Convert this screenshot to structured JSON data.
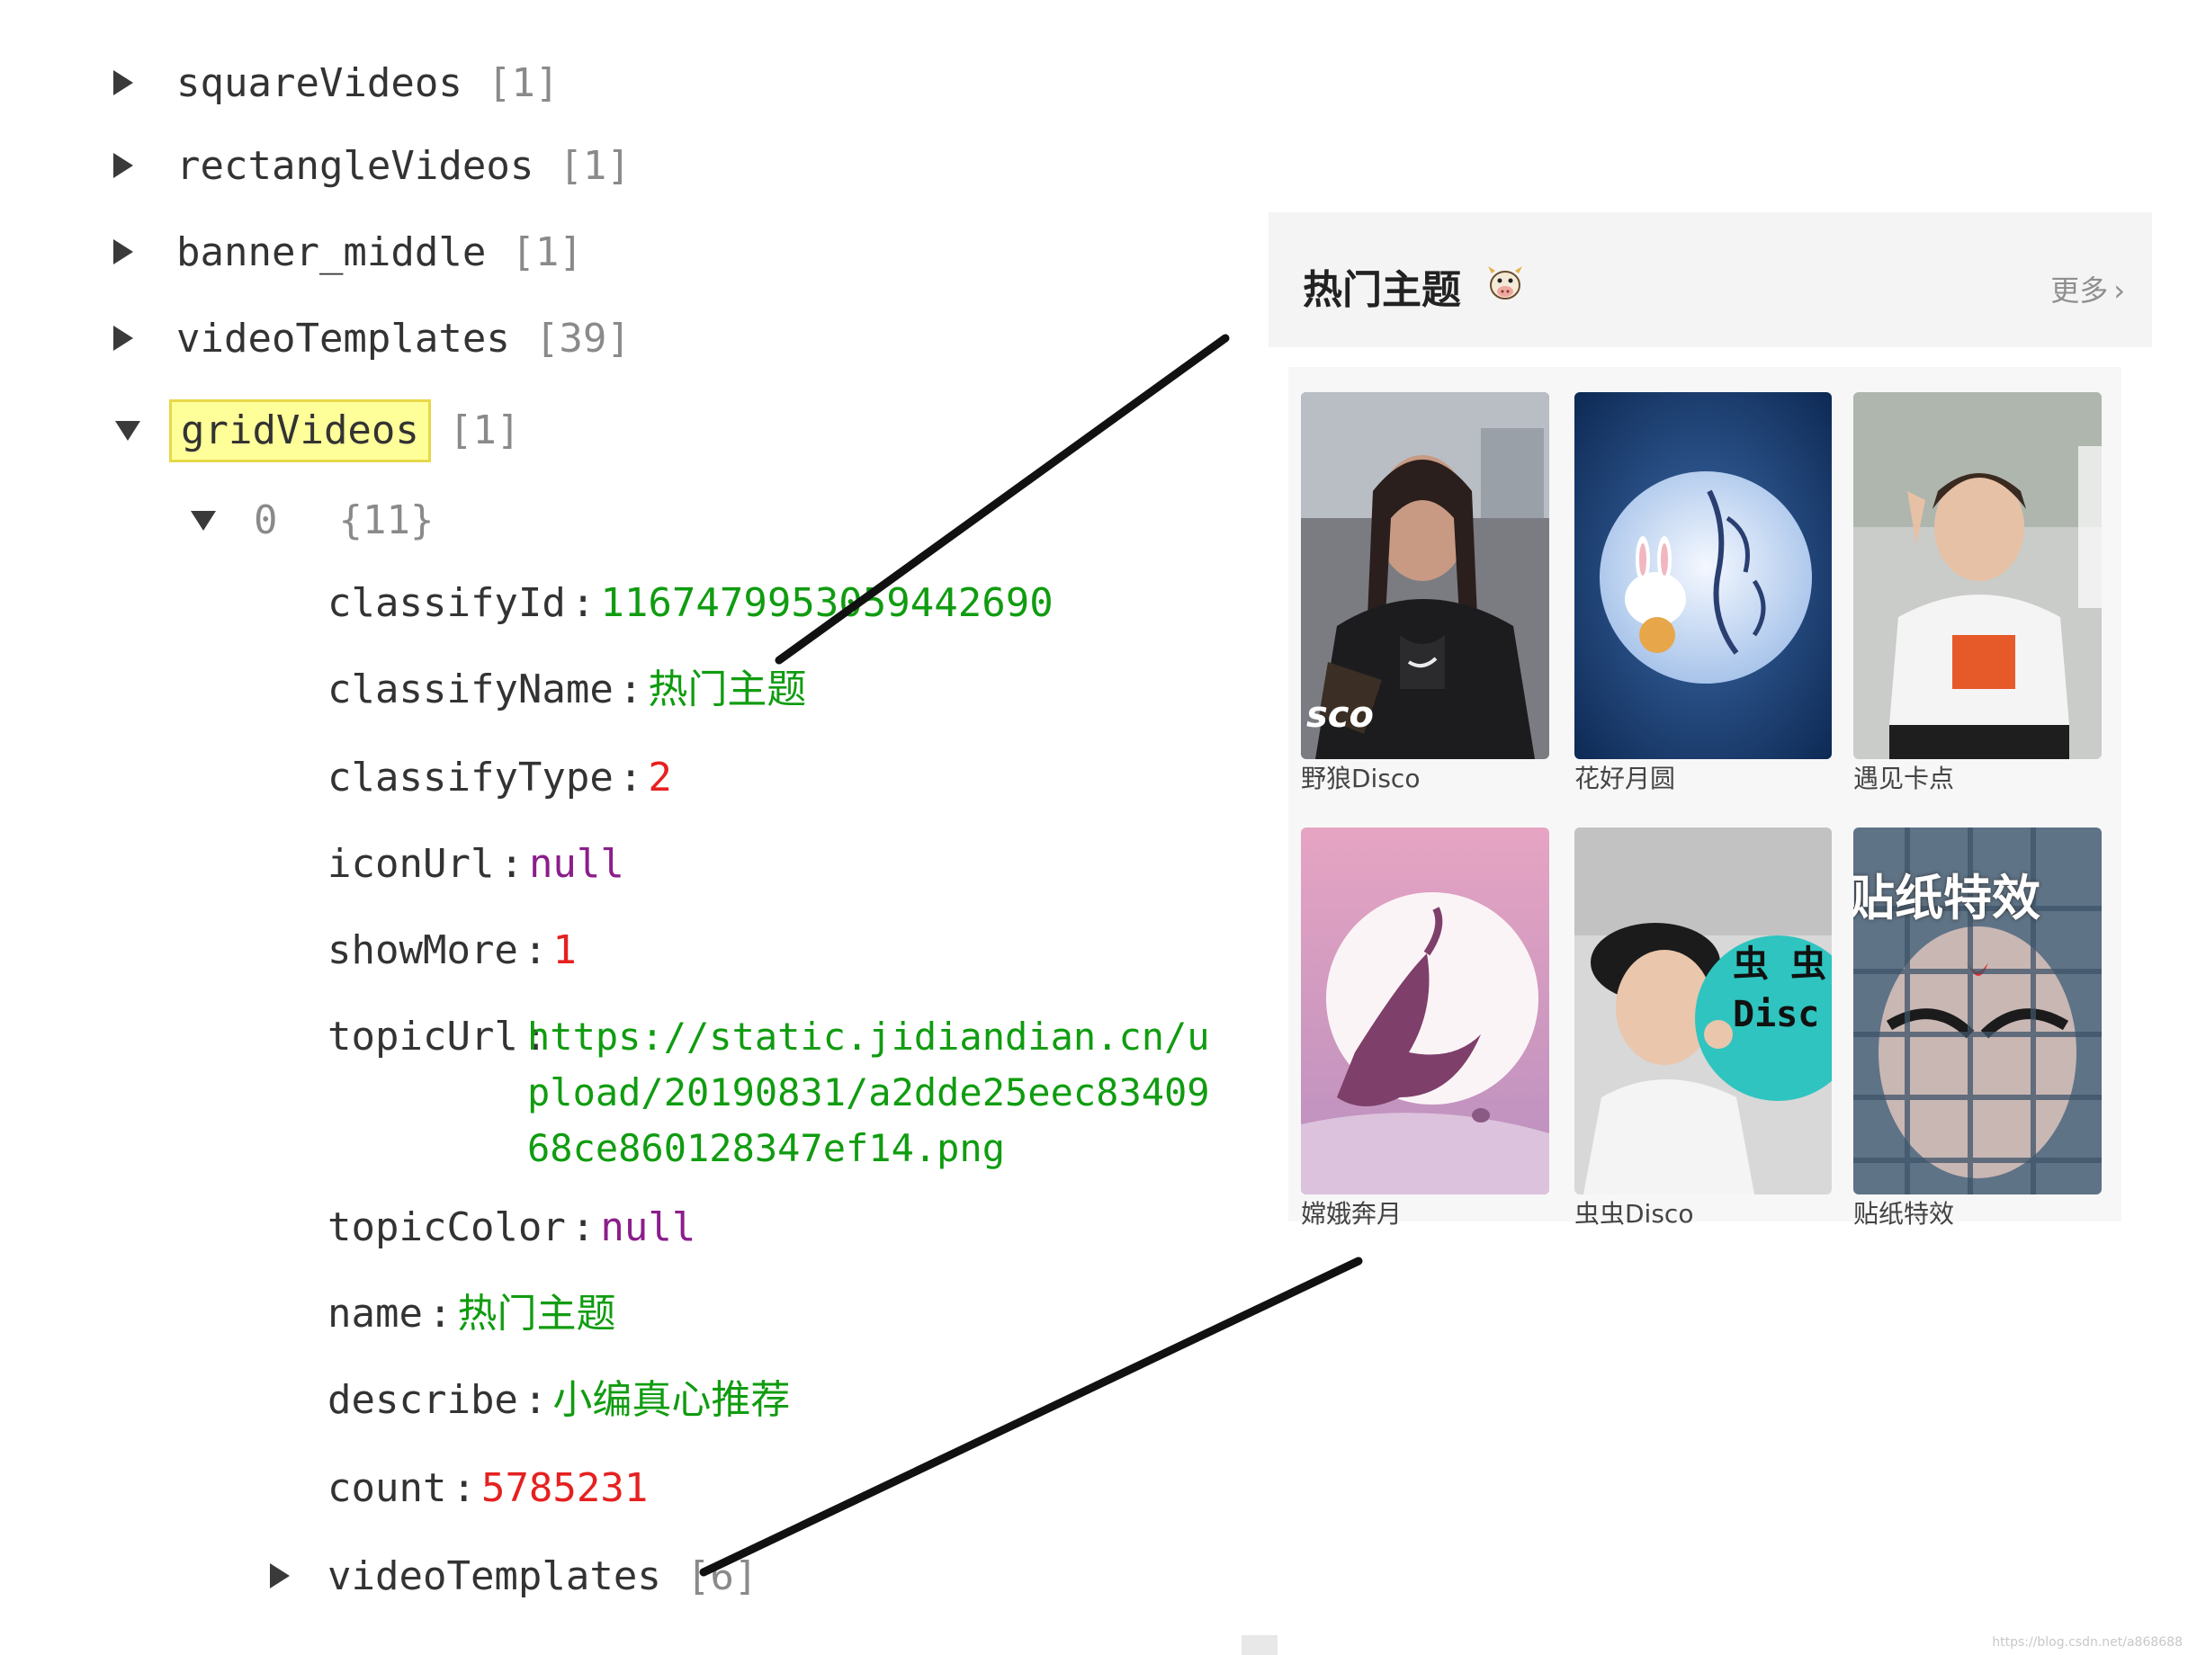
{
  "tree": {
    "top_nodes": [
      {
        "key": "squareVideos",
        "count": "[1]"
      },
      {
        "key": "rectangleVideos",
        "count": "[1]"
      },
      {
        "key": "banner_middle",
        "count": "[1]"
      },
      {
        "key": "videoTemplates",
        "count": "[39]"
      }
    ],
    "grid_node": {
      "key": "gridVideos",
      "count": "[1]"
    },
    "item_node": {
      "key": "0",
      "count": "{11}"
    },
    "fields": [
      {
        "key": "classifyId",
        "value": "1167479953059442690",
        "kind": "str"
      },
      {
        "key": "classifyName",
        "value": "热门主题",
        "kind": "str"
      },
      {
        "key": "classifyType",
        "value": "2",
        "kind": "num"
      },
      {
        "key": "iconUrl",
        "value": "null",
        "kind": "null"
      },
      {
        "key": "showMore",
        "value": "1",
        "kind": "num"
      }
    ],
    "topic_url": {
      "key": "topicUrl",
      "lines": [
        "https://static.jidiandian.cn/u",
        "pload/20190831/a2dde25eec83409",
        "68ce860128347ef14.png"
      ]
    },
    "fields_after": [
      {
        "key": "topicColor",
        "value": "null",
        "kind": "null"
      },
      {
        "key": "name",
        "value": "热门主题",
        "kind": "str"
      },
      {
        "key": "describe",
        "value": "小编真心推荐",
        "kind": "str"
      },
      {
        "key": "count",
        "value": "5785231",
        "kind": "num"
      }
    ],
    "child_node": {
      "key": "videoTemplates",
      "count": "[6]"
    }
  },
  "panel": {
    "title": "热门主题",
    "title_icon": "cow-emoji-icon",
    "more_label": "更多",
    "more_icon": "chevron-right-icon"
  },
  "grid": {
    "items": [
      {
        "label": "野狼Disco",
        "overlay": "sco"
      },
      {
        "label": "花好月圆",
        "overlay": ""
      },
      {
        "label": "遇见卡点",
        "overlay": ""
      },
      {
        "label": "嫦娥奔月",
        "overlay": ""
      },
      {
        "label": "虫虫Disco",
        "overlay": "虫 虫 Disc"
      },
      {
        "label": "贴纸特效",
        "overlay": "贴纸特效"
      }
    ]
  },
  "watermark": "https://blog.csdn.net/a868688",
  "colors": {
    "num": "#e62020",
    "str": "#109c10",
    "null": "#8b1e8b",
    "highlight": "#ffff99"
  }
}
